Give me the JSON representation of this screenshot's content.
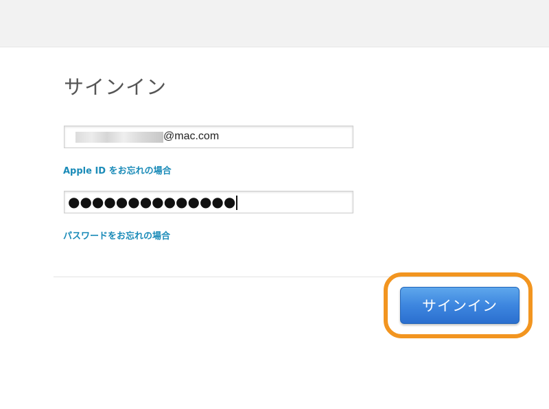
{
  "page": {
    "title": "サインイン"
  },
  "form": {
    "email": {
      "domain_text": "@mac.com"
    },
    "forgot_id_link": "Apple ID をお忘れの場合",
    "password": {
      "masked_value": "●●●●●●●●●●●●●●"
    },
    "forgot_password_link": "パスワードをお忘れの場合"
  },
  "actions": {
    "signin_button_label": "サインイン"
  },
  "colors": {
    "link": "#1a8bb8",
    "button": "#3d86df",
    "highlight": "#f29520"
  }
}
